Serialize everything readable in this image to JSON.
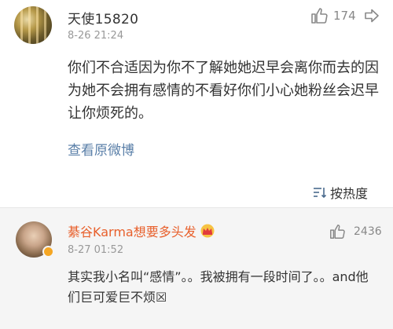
{
  "comment": {
    "username": "天使15820",
    "time": "8-26 21:24",
    "like_count": "174",
    "text": "你们不合适因为你不了解她她迟早会离你而去的因为她不会拥有感情的不看好你们小心她粉丝会迟早让你烦死的。",
    "view_original_label": "查看原微博"
  },
  "sort": {
    "label": "按热度"
  },
  "reply": {
    "username": "綦谷Karma想要多头发",
    "time": "8-27 01:52",
    "like_count": "2436",
    "text": "其实我小名叫“感情”。。我被拥有一段时间了。。and他们巨可爱巨不烦☒"
  },
  "colors": {
    "link": "#5a7fa8",
    "reply_username": "#e8602c",
    "badge": "#f5a623"
  },
  "icons": [
    "thumbs-up-icon",
    "more-icon",
    "sort-icon",
    "crown-icon",
    "verified-badge-icon"
  ]
}
